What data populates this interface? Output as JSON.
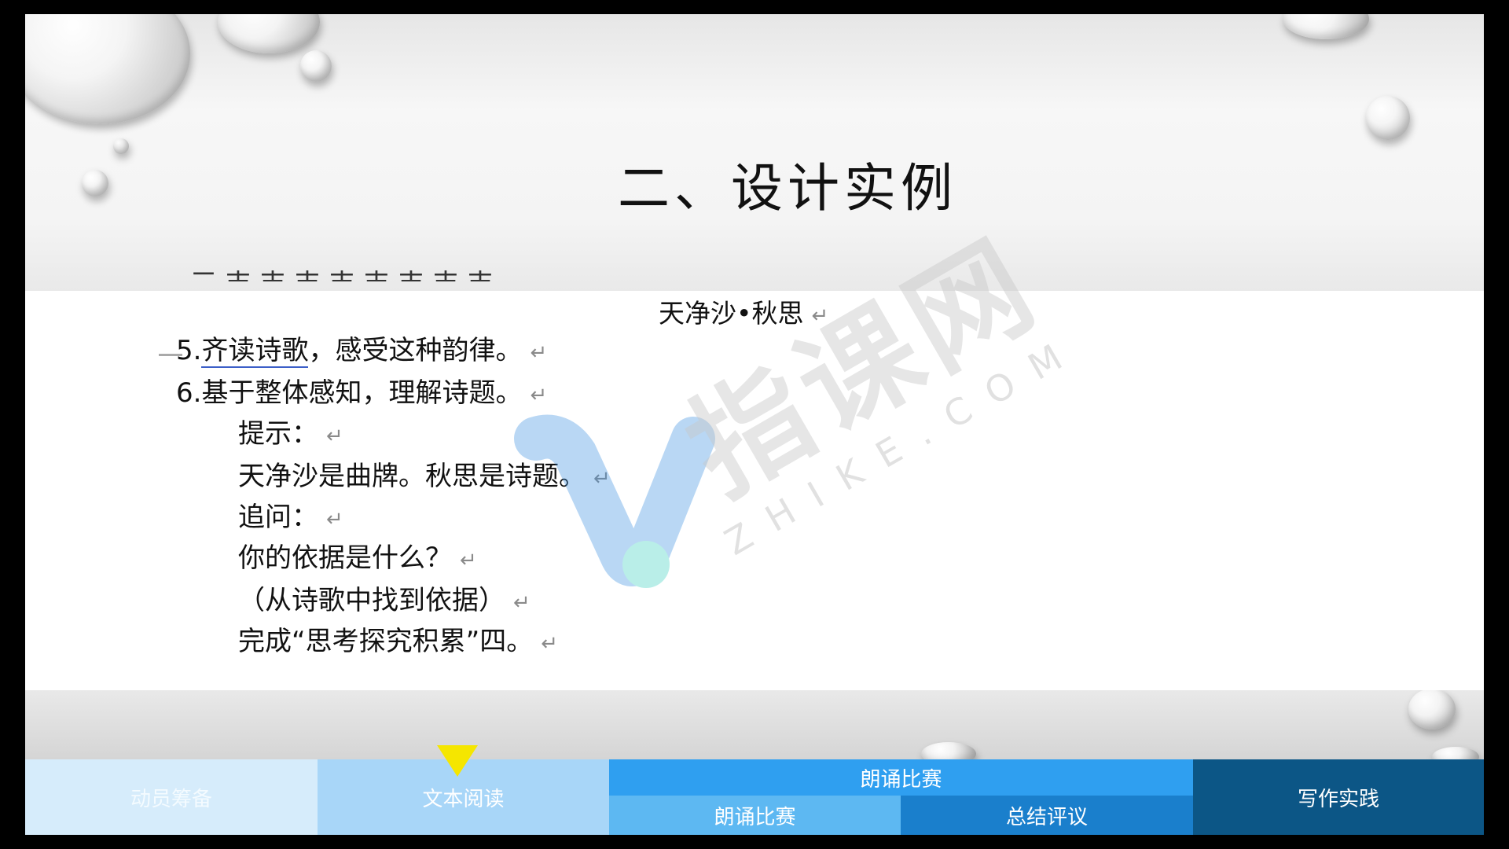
{
  "slide": {
    "title": "二、设计实例"
  },
  "document": {
    "poem_title": "天净沙•秋思",
    "return_mark": "↵",
    "lines": [
      {
        "text_a": "5.",
        "text_b": "齐读诗歌",
        "text_c": "，感受这种韵律。"
      },
      {
        "text": "6.基于整体感知，理解诗题。"
      },
      {
        "text": "提示："
      },
      {
        "text": "天净沙是曲牌。秋思是诗题。"
      },
      {
        "text": "追问："
      },
      {
        "text": "你的依据是什么？"
      },
      {
        "text": "（从诗歌中找到依据）"
      },
      {
        "text": "完成“思考探究积累”四。"
      }
    ]
  },
  "watermark": {
    "brand": "指课网",
    "domain": "ZHIKE.COM"
  },
  "nav": {
    "tab1": "动员筹备",
    "tab2": "文本阅读",
    "tab3": "朗诵比赛",
    "tab3a": "朗诵比赛",
    "tab3b": "总结评议",
    "tab4": "写作实践",
    "active_tab": "文本阅读",
    "marker_color": "#f5e600"
  }
}
